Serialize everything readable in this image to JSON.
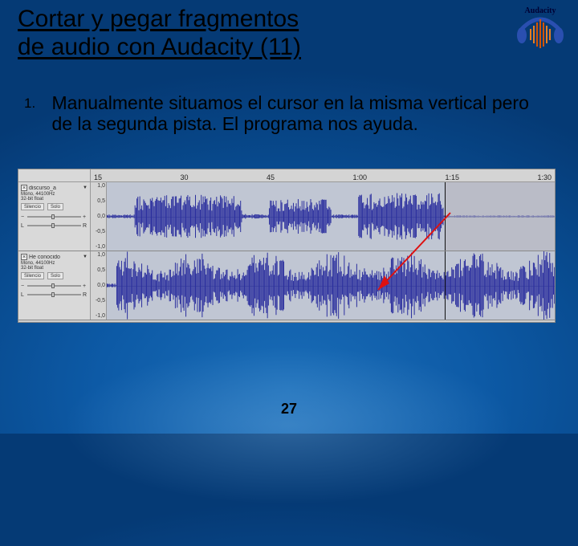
{
  "logo": {
    "name": "Audacity"
  },
  "title": {
    "line1": "Cortar y pegar fragmentos",
    "line2": "de audio  con Audacity (11)"
  },
  "list": {
    "num": "1.",
    "text": "Manualmente situamos el cursor en la misma vertical pero de la segunda pista. El programa nos ayuda."
  },
  "screenshot": {
    "ruler": {
      "ticks": [
        "15",
        "30",
        "45",
        "1:00",
        "1:15",
        "1:30"
      ]
    },
    "vscale": {
      "t": "1,0",
      "m1": "0,5",
      "c": "0,0",
      "m2": "-0,5",
      "b": "-1,0"
    },
    "track1": {
      "name": "discurso_a",
      "info1": "Mono, 44100Hz",
      "info2": "32-bit float",
      "btn_mute": "Silencio",
      "btn_solo": "Solo"
    },
    "track2": {
      "name": "He conocido",
      "info1": "Mono, 44100Hz",
      "info2": "32-bit float",
      "btn_mute": "Silencio",
      "btn_solo": "Solo"
    }
  },
  "page_number": "27"
}
